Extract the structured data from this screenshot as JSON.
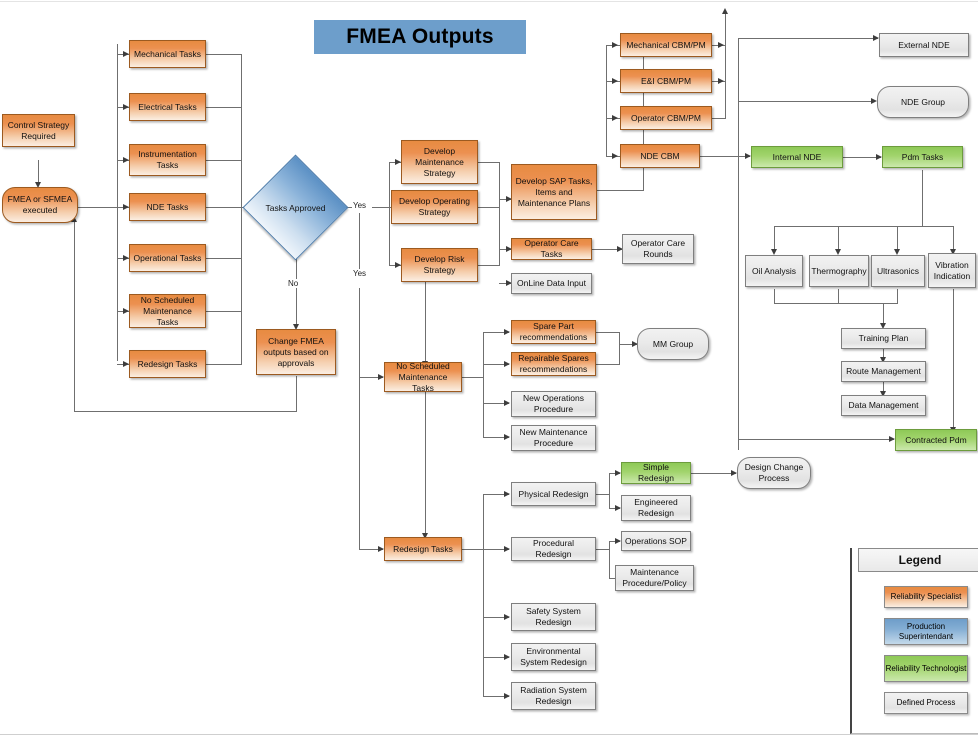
{
  "title": "FMEA Outputs",
  "nodes": {
    "control_strategy": "Control Strategy Required",
    "fmea_executed": "FMEA or SFMEA executed",
    "mechanical_tasks": "Mechanical Tasks",
    "electrical_tasks": "Electrical Tasks",
    "instrumentation_tasks": "Instrumentation Tasks",
    "nde_tasks": "NDE Tasks",
    "operational_tasks": "Operational Tasks",
    "no_sched_maint_tasks_left": "No Scheduled Maintenance Tasks",
    "redesign_tasks_left": "Redesign Tasks",
    "tasks_approved": "Tasks Approved",
    "change_fmea": "Change FMEA outputs based on approvals",
    "develop_maintenance_strategy": "Develop Maintenance Strategy",
    "develop_operating_strategy": "Develop Operating Strategy",
    "develop_risk_strategy": "Develop Risk Strategy",
    "develop_sap_tasks": "Develop SAP Tasks, Items and Maintenance Plans",
    "operator_care_tasks": "Operator Care Tasks",
    "online_data_input": "OnLine Data Input",
    "operator_care_rounds": "Operator Care Rounds",
    "mechanical_cbm_pm": "Mechanical CBM/PM",
    "ei_cbm_pm": "E&I CBM/PM",
    "operator_cbm_pm": "Operator CBM/PM",
    "nde_cbm": "NDE CBM",
    "external_nde": "External NDE",
    "nde_group": "NDE Group",
    "internal_nde": "Internal NDE",
    "pdm_tasks": "Pdm Tasks",
    "oil_analysis": "Oil Analysis",
    "thermography": "Thermography",
    "ultrasonics": "Ultrasonics",
    "vibration_indication": "Vibration Indication",
    "training_plan": "Training Plan",
    "route_management": "Route Management",
    "data_management": "Data Management",
    "contracted_pdm": "Contracted Pdm",
    "no_sched_maint_tasks_mid": "No Scheduled Maintenance Tasks",
    "spare_part_rec": "Spare Part recommendations",
    "repairable_spares_rec": "Repairable Spares recommendations",
    "mm_group": "MM Group",
    "new_operations_procedure": "New Operations Procedure",
    "new_maintenance_procedure": "New Maintenance Procedure",
    "redesign_tasks_mid": "Redesign Tasks",
    "physical_redesign": "Physical Redesign",
    "procedural_redesign": "Procedural Redesign",
    "simple_redesign": "Simple Redesign",
    "engineered_redesign": "Engineered Redesign",
    "design_change_process": "Design Change Process",
    "operations_sop": "Operations SOP",
    "maintenance_procedure_policy": "Maintenance Procedure/Policy",
    "safety_system_redesign": "Safety System Redesign",
    "environmental_system_redesign": "Environmental System Redesign",
    "radiation_system_redesign": "Radiation System Redesign"
  },
  "edge_labels": {
    "yes_top": "Yes",
    "yes_lower": "Yes",
    "no": "No"
  },
  "legend": {
    "title": "Legend",
    "items": [
      {
        "label": "Reliability Specialist",
        "role": "orange",
        "color": "#e78b41"
      },
      {
        "label": "Production Superintendant",
        "role": "blue",
        "color": "#6e9dc9"
      },
      {
        "label": "Reliability Technologist",
        "role": "green",
        "color": "#8ec957"
      },
      {
        "label": "Defined Process",
        "role": "grey",
        "color": "#eaeaea"
      }
    ]
  },
  "colors": {
    "banner": "#6d9ecb",
    "orange": "#e78b41",
    "green": "#8ec957",
    "blue": "#6e9dc9",
    "grey": "#eaeaea",
    "connector": "#6f6f6f"
  }
}
